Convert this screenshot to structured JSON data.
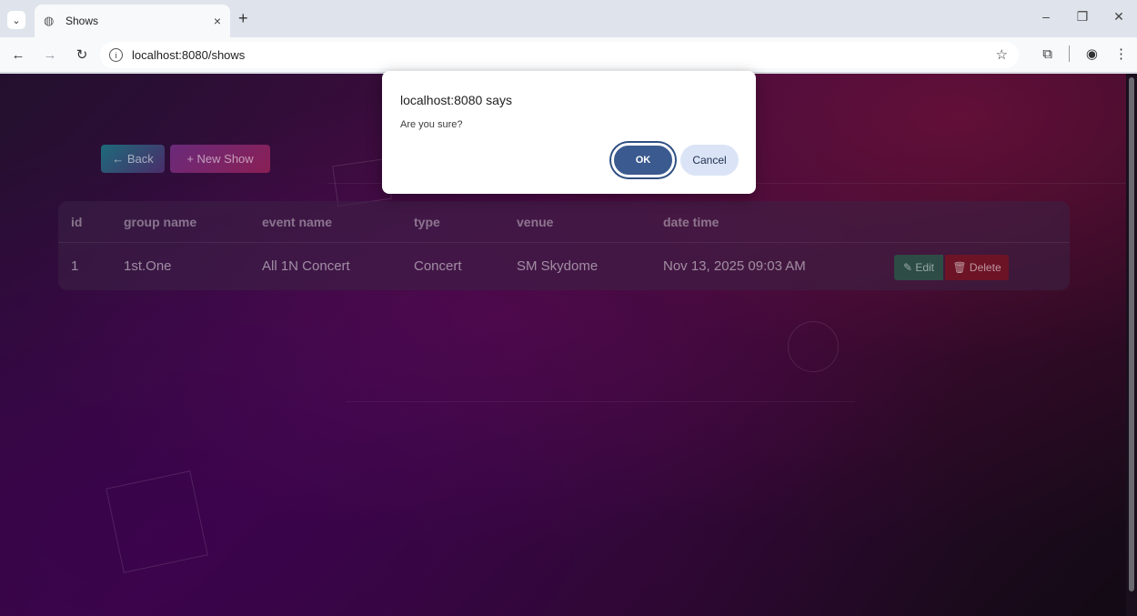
{
  "browser": {
    "tab_title": "Shows",
    "tab_close": "×",
    "new_tab": "+",
    "url": "localhost:8080/shows",
    "window": {
      "minimize": "–",
      "restore": "❐",
      "close": "✕"
    }
  },
  "page": {
    "back_label": "← Back",
    "new_show_label": "+ New Show",
    "table": {
      "headers": [
        "id",
        "group name",
        "event name",
        "type",
        "venue",
        "date time"
      ],
      "rows": [
        {
          "id": "1",
          "group_name": "1st.One",
          "event_name": "All 1N Concert",
          "type": "Concert",
          "venue": "SM Skydome",
          "date_time": "Nov 13, 2025 09:03 AM"
        }
      ],
      "edit_label": "✎ Edit",
      "delete_label": "🗑 Delete"
    }
  },
  "dialog": {
    "title": "localhost:8080 says",
    "message": "Are you sure?",
    "ok_label": "OK",
    "cancel_label": "Cancel"
  },
  "colors": {
    "ok_button": "#3b5a8f",
    "cancel_button": "#dbe4f6",
    "delete_button": "#6c1426",
    "edit_button": "#2d4c45"
  }
}
